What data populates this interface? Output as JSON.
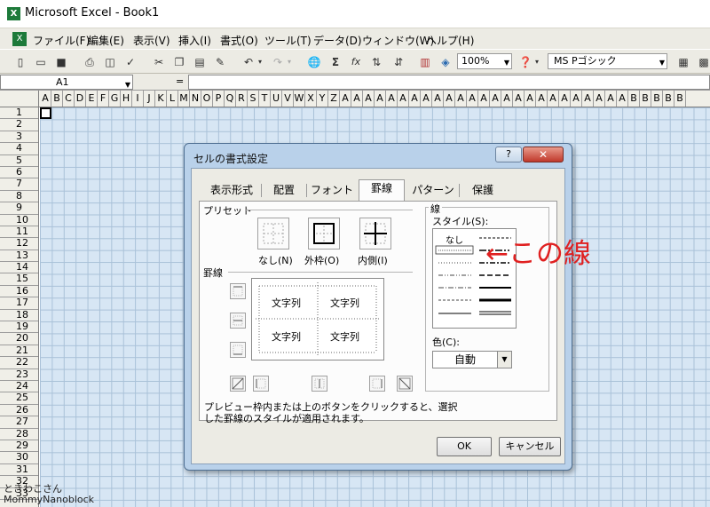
{
  "window": {
    "title": "Microsoft Excel - Book1",
    "app_icon": "excel-icon"
  },
  "menu": [
    {
      "label": "ファイル(F)"
    },
    {
      "label": "編集(E)"
    },
    {
      "label": "表示(V)"
    },
    {
      "label": "挿入(I)"
    },
    {
      "label": "書式(O)"
    },
    {
      "label": "ツール(T)"
    },
    {
      "label": "データ(D)"
    },
    {
      "label": "ウィンドウ(W)"
    },
    {
      "label": "ヘルプ(H)"
    }
  ],
  "toolbar": {
    "zoom": "100%",
    "font": "MS Pゴシック",
    "sum": "Σ",
    "fx": "fx"
  },
  "formula_bar": {
    "name_box": "A1",
    "equals": "="
  },
  "sheet": {
    "columns": [
      "A",
      "B",
      "C",
      "D",
      "E",
      "F",
      "G",
      "H",
      "I",
      "J",
      "K",
      "L",
      "M",
      "N",
      "O",
      "P",
      "Q",
      "R",
      "S",
      "T",
      "U",
      "V",
      "W",
      "X",
      "Y",
      "Z",
      "A",
      "A",
      "A",
      "A",
      "A",
      "A",
      "A",
      "A",
      "A",
      "A",
      "A",
      "A",
      "A",
      "A",
      "A",
      "A",
      "A",
      "A",
      "A",
      "A",
      "A",
      "A",
      "A",
      "A",
      "A",
      "B",
      "B",
      "B",
      "B",
      "B"
    ],
    "rows": [
      "1",
      "2",
      "3",
      "4",
      "5",
      "6",
      "7",
      "8",
      "9",
      "10",
      "11",
      "12",
      "13",
      "14",
      "15",
      "16",
      "17",
      "18",
      "19",
      "20",
      "21",
      "22",
      "23",
      "24",
      "25",
      "26",
      "27",
      "28",
      "29",
      "30",
      "31",
      "32",
      "33"
    ]
  },
  "watermark": {
    "line1": "ときわこさん",
    "line2": "MommyNanoblock"
  },
  "dialog": {
    "title": "セルの書式設定",
    "help_button": "?",
    "close_button": "✕",
    "tabs": [
      "表示形式",
      "配置",
      "フォント",
      "罫線",
      "パターン",
      "保護"
    ],
    "active_tab": "罫線",
    "preset_group": "プリセット",
    "presets": [
      "なし(N)",
      "外枠(O)",
      "内側(I)"
    ],
    "border_group": "罫線",
    "preview_text": [
      "文字列",
      "文字列",
      "文字列",
      "文字列"
    ],
    "line_group": "線",
    "style_label": "スタイル(S):",
    "style_none": "なし",
    "color_label": "色(C):",
    "color_value": "自動",
    "description": "プレビュー枠内または上のボタンをクリックすると、選択した罫線のスタイルが適用されます。",
    "ok_button": "OK",
    "cancel_button": "キャンセル"
  },
  "annotation": {
    "text": "←この線",
    "color": "#e02020"
  }
}
